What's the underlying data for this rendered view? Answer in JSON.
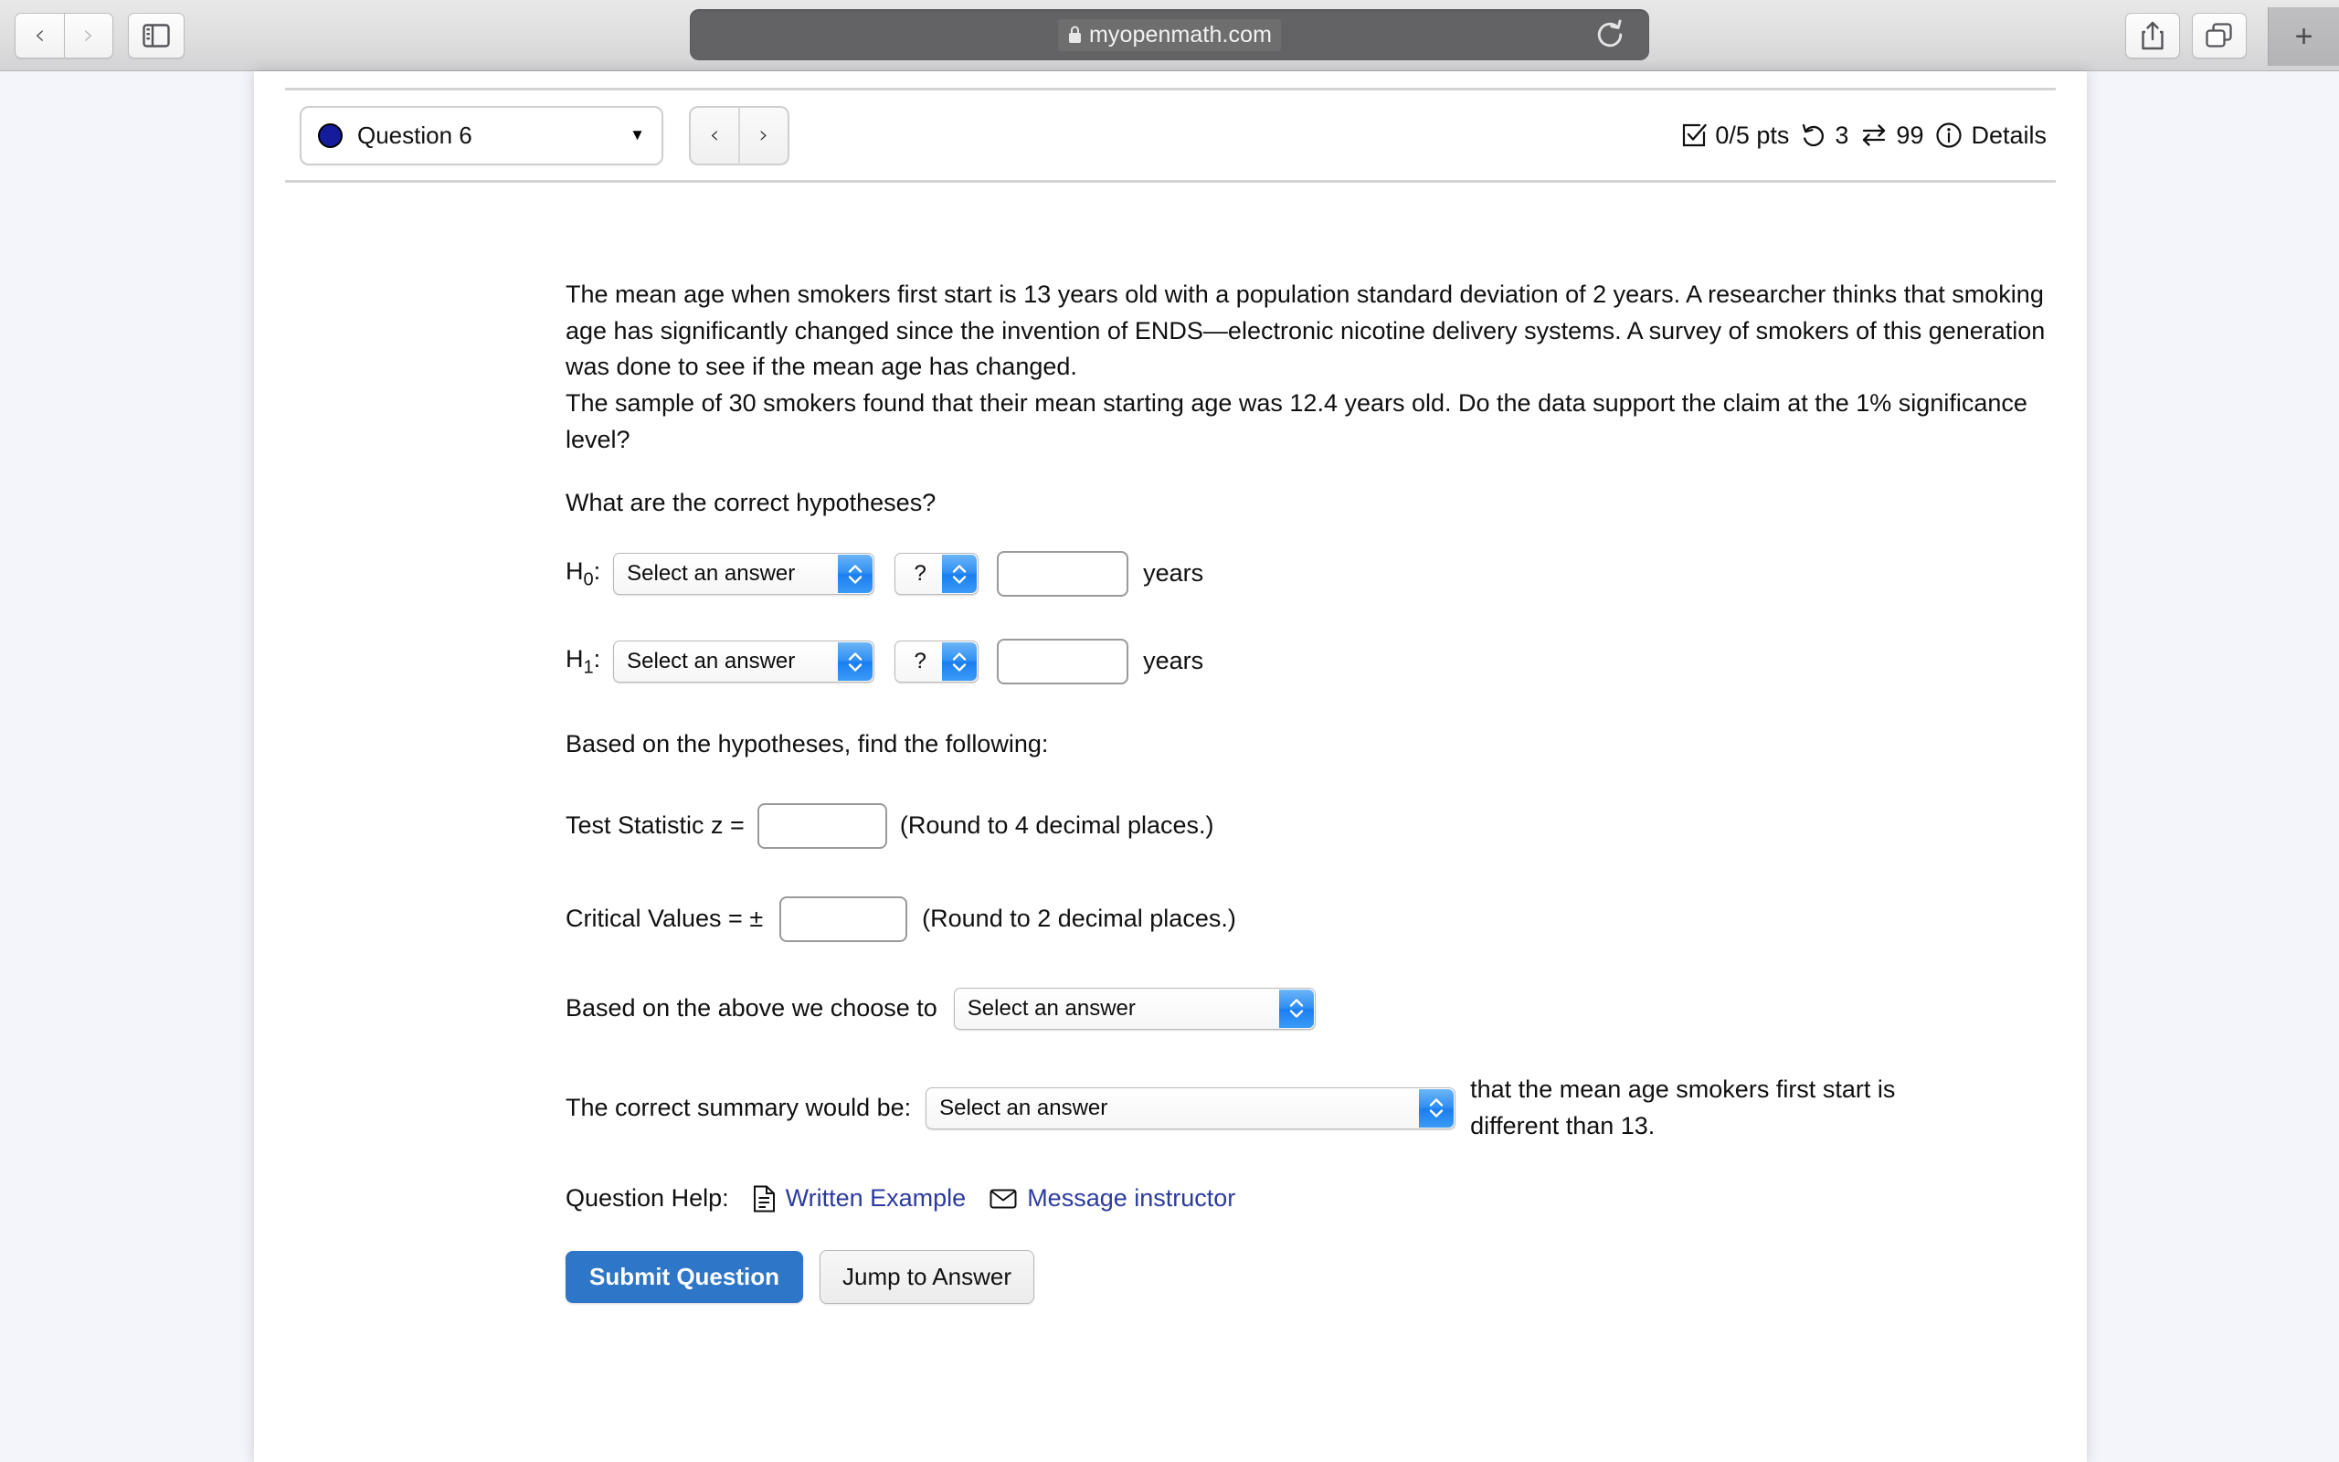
{
  "browser": {
    "back_icon": "chevron-left-icon",
    "forward_icon": "chevron-right-icon",
    "sidebar_icon": "sidebar-toggle-icon",
    "url": "myopenmath.com",
    "lock_icon": "lock-icon",
    "reload_icon": "reload-icon",
    "share_icon": "share-icon",
    "tabs_icon": "tab-overview-icon",
    "new_tab_label": "+"
  },
  "question_header": {
    "selected_question": "Question 6",
    "status_dot_color": "#141c9c",
    "caret": "▼",
    "prev_label": "‹",
    "next_label": "›",
    "points": "0/5 pts",
    "attempts": "3",
    "versions": "99",
    "details_label": "Details",
    "points_icon": "checkbox-icon",
    "attempts_icon": "undo-arrow-icon",
    "versions_icon": "swap-arrows-icon",
    "details_icon": "info-circle-icon"
  },
  "question": {
    "prompt_lines": [
      "The mean age when smokers first start is 13 years old with a population standard deviation of 2 years. A researcher thinks that smoking age has significantly changed since the invention of ENDS—electronic nicotine delivery systems. A survey of smokers of this generation was done to see if the mean age has changed.",
      "The sample of 30 smokers found that their mean starting age was 12.4 years old. Do the data support the claim at the 1% significance level?"
    ],
    "hypotheses_prompt": "What are the correct hypotheses?",
    "h0_label": "H",
    "h0_sub": "0",
    "h1_label": "H",
    "h1_sub": "1",
    "colon": ":",
    "select_placeholder": "Select an answer",
    "comparator_placeholder": "?",
    "h0_value": "",
    "h1_value": "",
    "unit_label": "years",
    "find_prompt": "Based on the hypotheses, find the following:",
    "test_statistic_label": "Test Statistic z =",
    "test_statistic_value": "",
    "test_statistic_hint": "(Round to 4 decimal places.)",
    "critical_values_label": "Critical Values = ±",
    "critical_values_value": "",
    "critical_values_hint": "(Round to 2 decimal places.)",
    "decision_label": "Based on the above we choose to",
    "decision_value": "Select an answer",
    "summary_label": "The correct summary would be:",
    "summary_value": "Select an answer",
    "summary_tail": "that the mean age smokers first start is different than 13."
  },
  "help": {
    "label": "Question Help:",
    "written_example": "Written Example",
    "written_example_icon": "document-icon",
    "message_instructor": "Message instructor",
    "message_instructor_icon": "envelope-icon",
    "link_color": "#2b3b9e"
  },
  "actions": {
    "submit_label": "Submit Question",
    "submit_color": "#2e76c8",
    "jump_label": "Jump to Answer"
  }
}
